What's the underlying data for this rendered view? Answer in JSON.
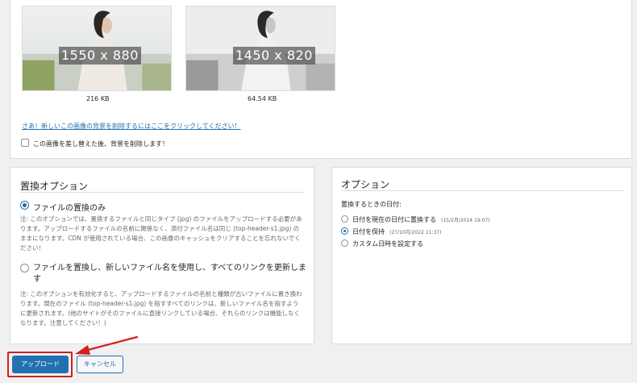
{
  "images": {
    "old": {
      "dimensions": "1550 x 880",
      "size": "216 KB"
    },
    "new": {
      "dimensions": "1450 x 820",
      "size": "64.54 KB"
    }
  },
  "background_removal": {
    "link": "さあ！新しいこの画像の背景を削除するにはここをクリックしてください！",
    "checkbox_label": "この画像を差し替えた後、背景を削除します！"
  },
  "replace_options": {
    "title": "置換オプション",
    "replace_only": {
      "label": "ファイルの置換のみ",
      "note": "注: このオプションでは、置換するファイルと同じタイプ (jpg) のファイルをアップロードする必要があります。アップロードするファイルの名前に関係なく、添付ファイル名は同じ (top-header-s1.jpg) のままになります。CDN が使用されている場合、この画像のキャッシュをクリアすることを忘れないでください！"
    },
    "replace_rename": {
      "label": "ファイルを置換し、新しいファイル名を使用し、すべてのリンクを更新します",
      "note": "注: このオプションを有効化すると、アップロードするファイルの名前と種類が古いファイルに置き換わります。現在のファイル (top-header-s1.jpg) を指すすべてのリンクは、新しいファイル名を指すように更新されます。(他のサイトがそのファイルに直接リンクしている場合、それらのリンクは機能しなくなります。注意してください！)"
    }
  },
  "options": {
    "title": "オプション",
    "date_heading": "置換するときの日付:",
    "date_now": {
      "label": "日付を現在の日付に置換する",
      "date": "(15/2月/2024 19:07)"
    },
    "date_keep": {
      "label": "日付を保持",
      "date": "(27/10月/2022 11:37)"
    },
    "date_custom": {
      "label": "カスタム日時を設定する"
    }
  },
  "buttons": {
    "upload": "アップロード",
    "cancel": "キャンセル"
  },
  "colors": {
    "accent": "#2271b1",
    "highlight": "#d21f1f"
  }
}
